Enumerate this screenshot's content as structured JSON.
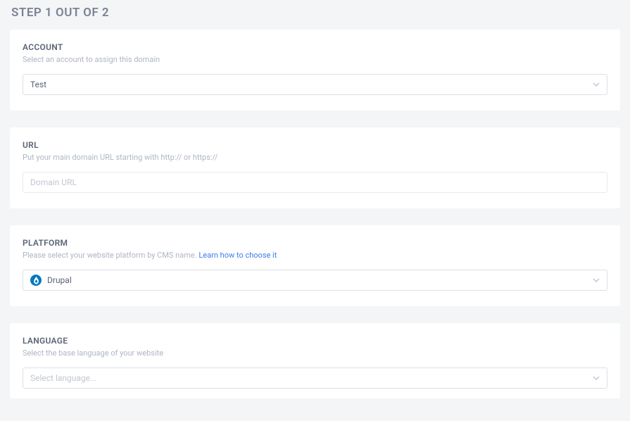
{
  "heading": "STEP 1 OUT OF 2",
  "account": {
    "title": "ACCOUNT",
    "subtitle": "Select an account to assign this domain",
    "value": "Test"
  },
  "url": {
    "title": "URL",
    "subtitle": "Put your main domain URL starting with http:// or https://",
    "placeholder": "Domain URL"
  },
  "platform": {
    "title": "PLATFORM",
    "subtitle_prefix": "Please select your website platform by CMS name.  ",
    "link_text": "Learn how to choose it",
    "value": "Drupal",
    "icon": "drupal-icon"
  },
  "language": {
    "title": "LANGUAGE",
    "subtitle": "Select the base language of your website",
    "placeholder": "Select language..."
  }
}
